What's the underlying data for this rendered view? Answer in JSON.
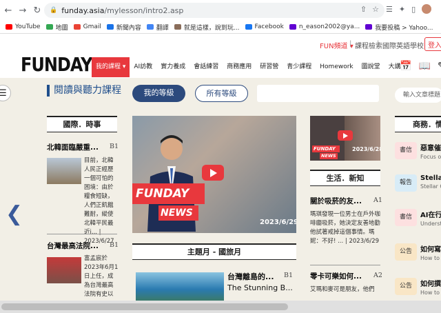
{
  "browser": {
    "url_host": "funday.asia",
    "url_path": "/mylesson/intro2.asp",
    "bookmarks": [
      {
        "label": "YouTube",
        "color": "#ff0000"
      },
      {
        "label": "地圖",
        "color": "#34a853"
      },
      {
        "label": "Gmail",
        "color": "#ea4335"
      },
      {
        "label": "新聞內容",
        "color": "#1a73e8"
      },
      {
        "label": "翻譯",
        "color": "#4285f4"
      },
      {
        "label": "就是這樣，說到玩...",
        "color": "#8a6d5a"
      },
      {
        "label": "Facebook",
        "color": "#1877f2"
      },
      {
        "label": "n_eason2002@ya...",
        "color": "#6001d2"
      },
      {
        "label": "我要投稿 > Yahoo...",
        "color": "#6001d2"
      }
    ]
  },
  "site": {
    "logo": "FUNDAY",
    "fun_channel": "FUN頻道 ▾",
    "class_search": "課程檢索",
    "school": "國際英語學校",
    "login": "登入",
    "nav": [
      "我的課程 ▾",
      "AI訪教",
      "實力養成",
      "會話練習",
      "商務應用",
      "研習營",
      "青少課程",
      "Homework",
      "圖說堂",
      "大講堂"
    ]
  },
  "page": {
    "section_title": "閱讀與聽力課程",
    "tab_mine": "我的等級",
    "tab_all": "所有等級",
    "side_search_placeholder": "輸入文章標題",
    "col1_head": "國際．時事",
    "col1_items": [
      {
        "title": "北韓面臨嚴重...",
        "level": "B1",
        "snippet": "目前，北韓人民正經歷一個可怕的困境：由於糧食短缺，人們正飢餓難耐，縱使北韓平民最近i... | 2023/6/27"
      },
      {
        "title": "台灣最高法院...",
        "level": "B1",
        "snippet": "富孟宸於2023年6月1日上任，成為台灣最高法院有史以"
      }
    ],
    "hero_news_line1": "FUNDAY",
    "hero_news_line2": "NEWS",
    "hero_date": "2023/6/29",
    "small_news_line1": "FUNDAY",
    "small_news_line2": "NEWS",
    "small_date": "2023/6/28",
    "col3_head": "生活．新知",
    "col3_items": [
      {
        "title": "關於吸菸的友...",
        "level": "A1",
        "snippet": "瑪琪發現一位男士在戶外咖啡廳吸菸，她決定友善地勸他試著戒掉這個事情。瑪妮：不好! ... | 2023/6/29"
      },
      {
        "title": "零卡可樂如何...",
        "level": "A2",
        "snippet": "艾瑪和麥可是朋友，他們"
      }
    ],
    "theme_head": "主題月 - 國旅月",
    "theme_item": {
      "title": "台灣離島的...",
      "subtitle": "The Stunning B...",
      "level": "B1"
    },
    "col4_head": "商務．情",
    "col4_items": [
      {
        "badge": "書信",
        "badge_color": "#fde0e0",
        "title": "惡意催",
        "sub": "Focus on"
      },
      {
        "badge": "報告",
        "badge_color": "#d8ecf7",
        "title": "Stellar",
        "sub": "Stellar C"
      },
      {
        "badge": "書信",
        "badge_color": "#fde0e0",
        "title": "AI在行",
        "sub": "Underst"
      },
      {
        "badge": "公告",
        "badge_color": "#f9e6c6",
        "title": "如何寫",
        "sub": "How to W"
      },
      {
        "badge": "公告",
        "badge_color": "#f9e6c6",
        "title": "如何撰",
        "sub": "How to W"
      }
    ]
  }
}
